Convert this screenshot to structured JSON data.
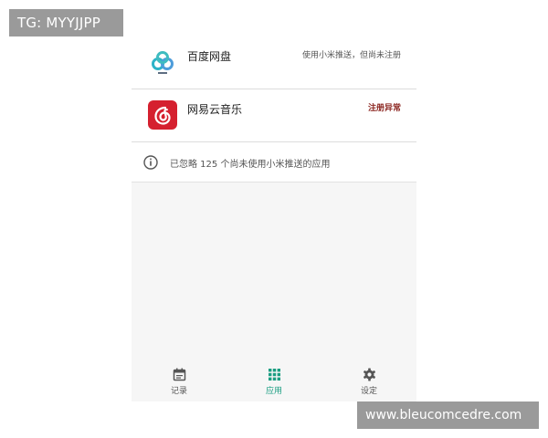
{
  "watermarks": {
    "top_left": "TG: MYYJJPP",
    "bottom_right": "www.bleucomcedre.com"
  },
  "apps": [
    {
      "name": "百度网盘",
      "status": "使用小米推送，但尚未注册",
      "icon": "baidu-netdisk-icon"
    },
    {
      "name": "网易云音乐",
      "status": "注册异常",
      "icon": "netease-cloud-music-icon",
      "status_color": "#8e2a25"
    }
  ],
  "info": {
    "text": "已忽略 125 个尚未使用小米推送的应用",
    "icon": "info-icon"
  },
  "nav": {
    "items": [
      {
        "label": "记录",
        "icon": "calendar-icon"
      },
      {
        "label": "应用",
        "icon": "grid-icon",
        "active": true
      },
      {
        "label": "设定",
        "icon": "gear-icon"
      }
    ],
    "active_color": "#1b9e82"
  }
}
